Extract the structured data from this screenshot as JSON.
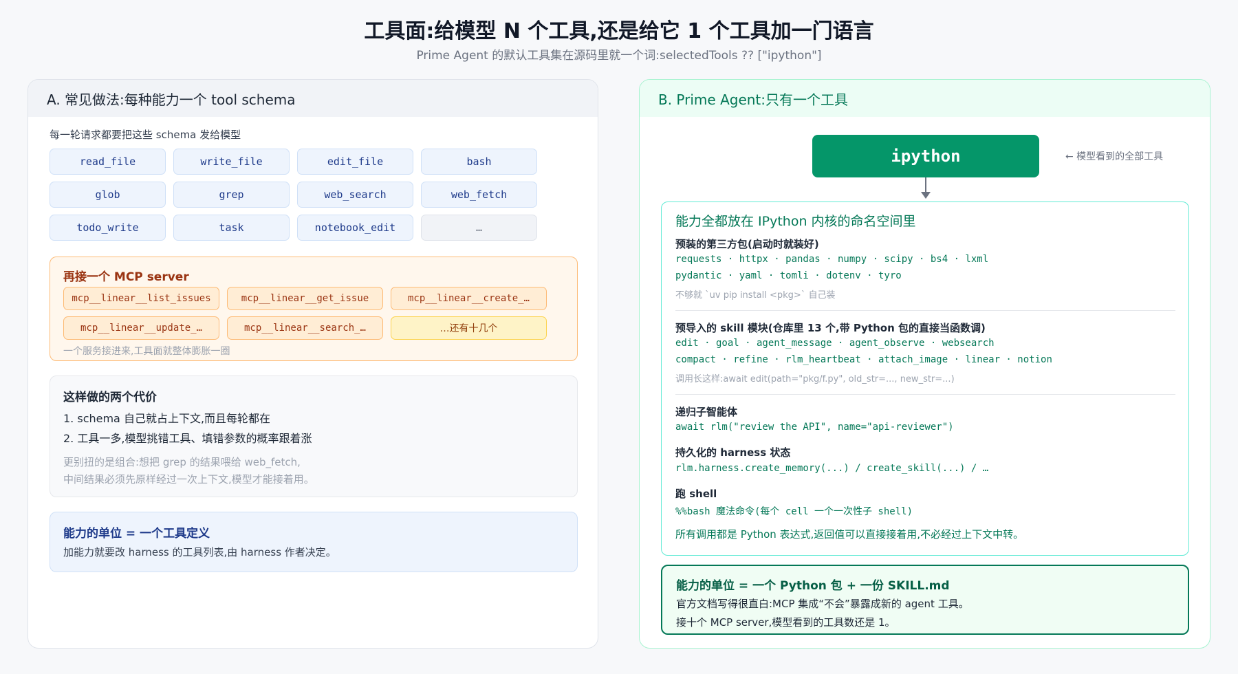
{
  "header": {
    "title": "工具面:给模型 N 个工具,还是给它 1 个工具加一门语言",
    "subtitle": "Prime Agent 的默认工具集在源码里就一个词:selectedTools ?? [\"ipython\"]"
  },
  "panel_a": {
    "title": "A. 常见做法:每种能力一个 tool schema",
    "schema_caption": "每一轮请求都要把这些 schema 发给模型",
    "tools": [
      "read_file",
      "write_file",
      "edit_file",
      "bash",
      "glob",
      "grep",
      "web_search",
      "web_fetch",
      "todo_write",
      "task",
      "notebook_edit",
      "…"
    ],
    "mcp": {
      "title": "再接一个 MCP server",
      "tools": [
        "mcp__linear__list_issues",
        "mcp__linear__get_issue",
        "mcp__linear__create_…",
        "mcp__linear__update_…",
        "mcp__linear__search_…",
        "…还有十几个"
      ],
      "note": "一个服务接进来,工具面就整体膨胀一圈"
    },
    "costs": {
      "title": "这样做的两个代价",
      "items": [
        "1. schema 自己就占上下文,而且每轮都在",
        "2. 工具一多,模型挑错工具、填错参数的概率跟着涨"
      ],
      "note_1": "更别扭的是组合:想把 grep 的结果喂给 web_fetch,",
      "note_2": "中间结果必须先原样经过一次上下文,模型才能接着用。"
    },
    "unit": {
      "title": "能力的单位 = 一个工具定义",
      "desc": "加能力就要改 harness 的工具列表,由 harness 作者决定。"
    }
  },
  "panel_b": {
    "title": "B. Prime Agent:只有一个工具",
    "tool": "ipython",
    "tool_note": "← 模型看到的全部工具",
    "namespace": {
      "title": "能力全都放在 IPython 内核的命名空间里",
      "packages_head": "预装的第三方包(启动时就装好)",
      "packages_line1": "requests · httpx · pandas · numpy · scipy · bs4 · lxml",
      "packages_line2": "pydantic · yaml · tomli · dotenv · tyro",
      "packages_note": "不够就 `uv pip install <pkg>` 自己装",
      "skills_head": "预导入的 skill 模块(仓库里 13 个,带 Python 包的直接当函数调)",
      "skills_line1": "edit · goal · agent_message · agent_observe · websearch",
      "skills_line2": "compact · refine · rlm_heartbeat · attach_image · linear · notion",
      "skills_note": "调用长这样:await edit(path=\"pkg/f.py\", old_str=..., new_str=...)",
      "recursive_head": "递归子智能体",
      "recursive_code": "await rlm(\"review the API\", name=\"api-reviewer\")",
      "harness_head": "持久化的 harness 状态",
      "harness_code": "rlm.harness.create_memory(...) / create_skill(...) / …",
      "shell_head": "跑 shell",
      "shell_code": "%%bash 魔法命令(每个 cell 一个一次性子 shell)",
      "footer": "所有调用都是 Python 表达式,返回值可以直接接着用,不必经过上下文中转。"
    },
    "unit": {
      "title": "能力的单位 = 一个 Python 包 + 一份 SKILL.md",
      "line1": "官方文档写得很直白:MCP 集成“不会”暴露成新的 agent 工具。",
      "line2": "接十个 MCP server,模型看到的工具数还是 1。"
    }
  },
  "colors": {
    "panel_a_accent": "#1e3a8a",
    "mcp_accent": "#9a3412",
    "panel_b_accent": "#047857",
    "ipython_fill": "#059669"
  }
}
